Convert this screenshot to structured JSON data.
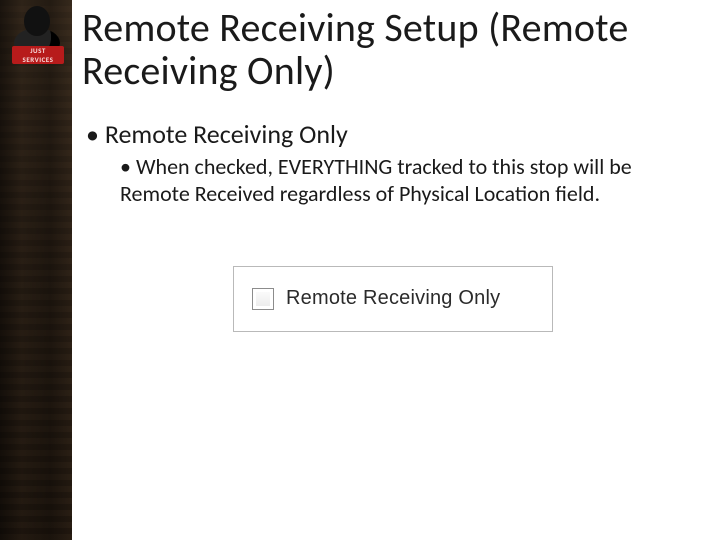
{
  "logo": {
    "line1": "JUST",
    "line2": "SERVICES"
  },
  "title": "Remote Receiving Setup (Remote Receiving Only)",
  "bullets": {
    "level1": "Remote Receiving Only",
    "level2": "When checked, EVERYTHING tracked to this stop will be Remote Received regardless of Physical Location field."
  },
  "checkbox": {
    "label": "Remote Receiving Only",
    "checked": false
  }
}
